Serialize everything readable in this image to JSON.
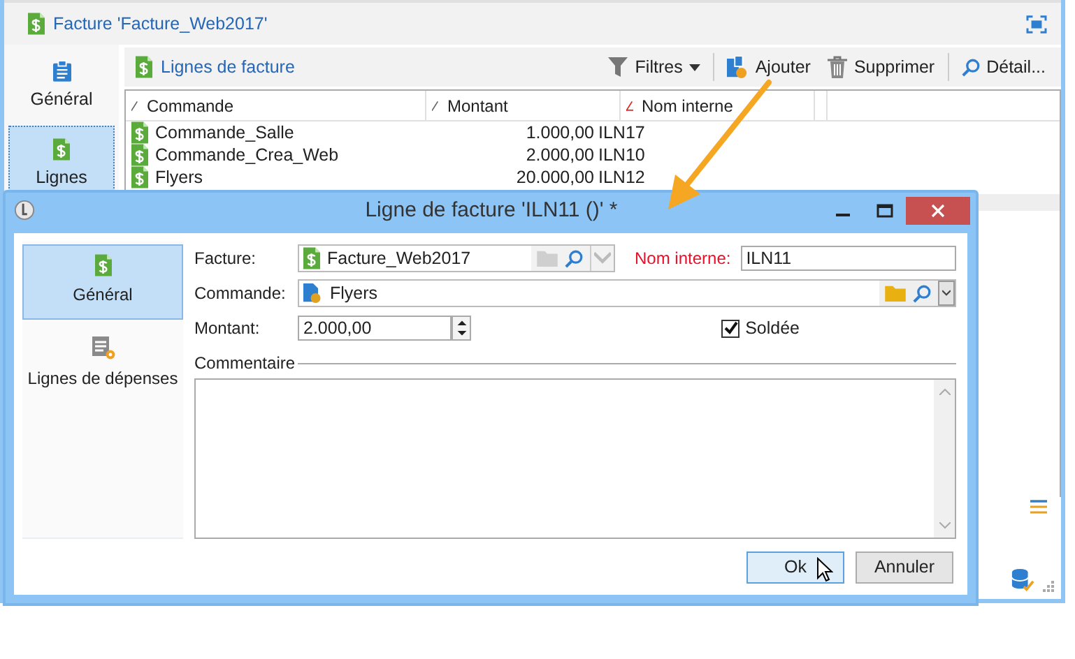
{
  "main_window": {
    "title": "Facture 'Facture_Web2017'",
    "sidebar": [
      {
        "label": "Général",
        "kind": "clipboard",
        "selected": false
      },
      {
        "label": "Lignes",
        "kind": "invoice",
        "selected": true
      }
    ],
    "section_title": "Lignes de facture",
    "toolbar": [
      {
        "label": "Filtres",
        "kind": "filter"
      },
      {
        "label": "Ajouter",
        "kind": "add"
      },
      {
        "label": "Supprimer",
        "kind": "delete"
      },
      {
        "label": "Détail...",
        "kind": "detail"
      }
    ],
    "table": {
      "columns": [
        {
          "label": "Commande",
          "required": false
        },
        {
          "label": "Montant",
          "required": false
        },
        {
          "label": "Nom interne",
          "required": true
        }
      ],
      "rows": [
        {
          "commande": "Commande_Salle",
          "montant": "1.000,00",
          "nom_interne": "ILN17"
        },
        {
          "commande": "Commande_Crea_Web",
          "montant": "2.000,00",
          "nom_interne": "ILN10"
        },
        {
          "commande": "Flyers",
          "montant": "20.000,00",
          "nom_interne": "ILN12"
        }
      ]
    }
  },
  "dialog": {
    "title": "Ligne de facture 'ILN11 ()' *",
    "nav": [
      {
        "label": "Général",
        "kind": "invoice",
        "selected": true
      },
      {
        "label": "Lignes de dépenses",
        "kind": "lines",
        "selected": false
      }
    ],
    "facture": {
      "label": "Facture:",
      "value": "Facture_Web2017"
    },
    "nom_interne": {
      "label": "Nom interne:",
      "value": "ILN11",
      "required": true
    },
    "commande": {
      "label": "Commande:",
      "value": "Flyers"
    },
    "montant": {
      "label": "Montant:",
      "value": "2.000,00"
    },
    "soldee": {
      "label": "Soldée",
      "checked": true
    },
    "commentaire": {
      "label": "Commentaire"
    },
    "buttons": [
      {
        "label": "Ok",
        "default": true
      },
      {
        "label": "Annuler",
        "default": false
      }
    ]
  }
}
